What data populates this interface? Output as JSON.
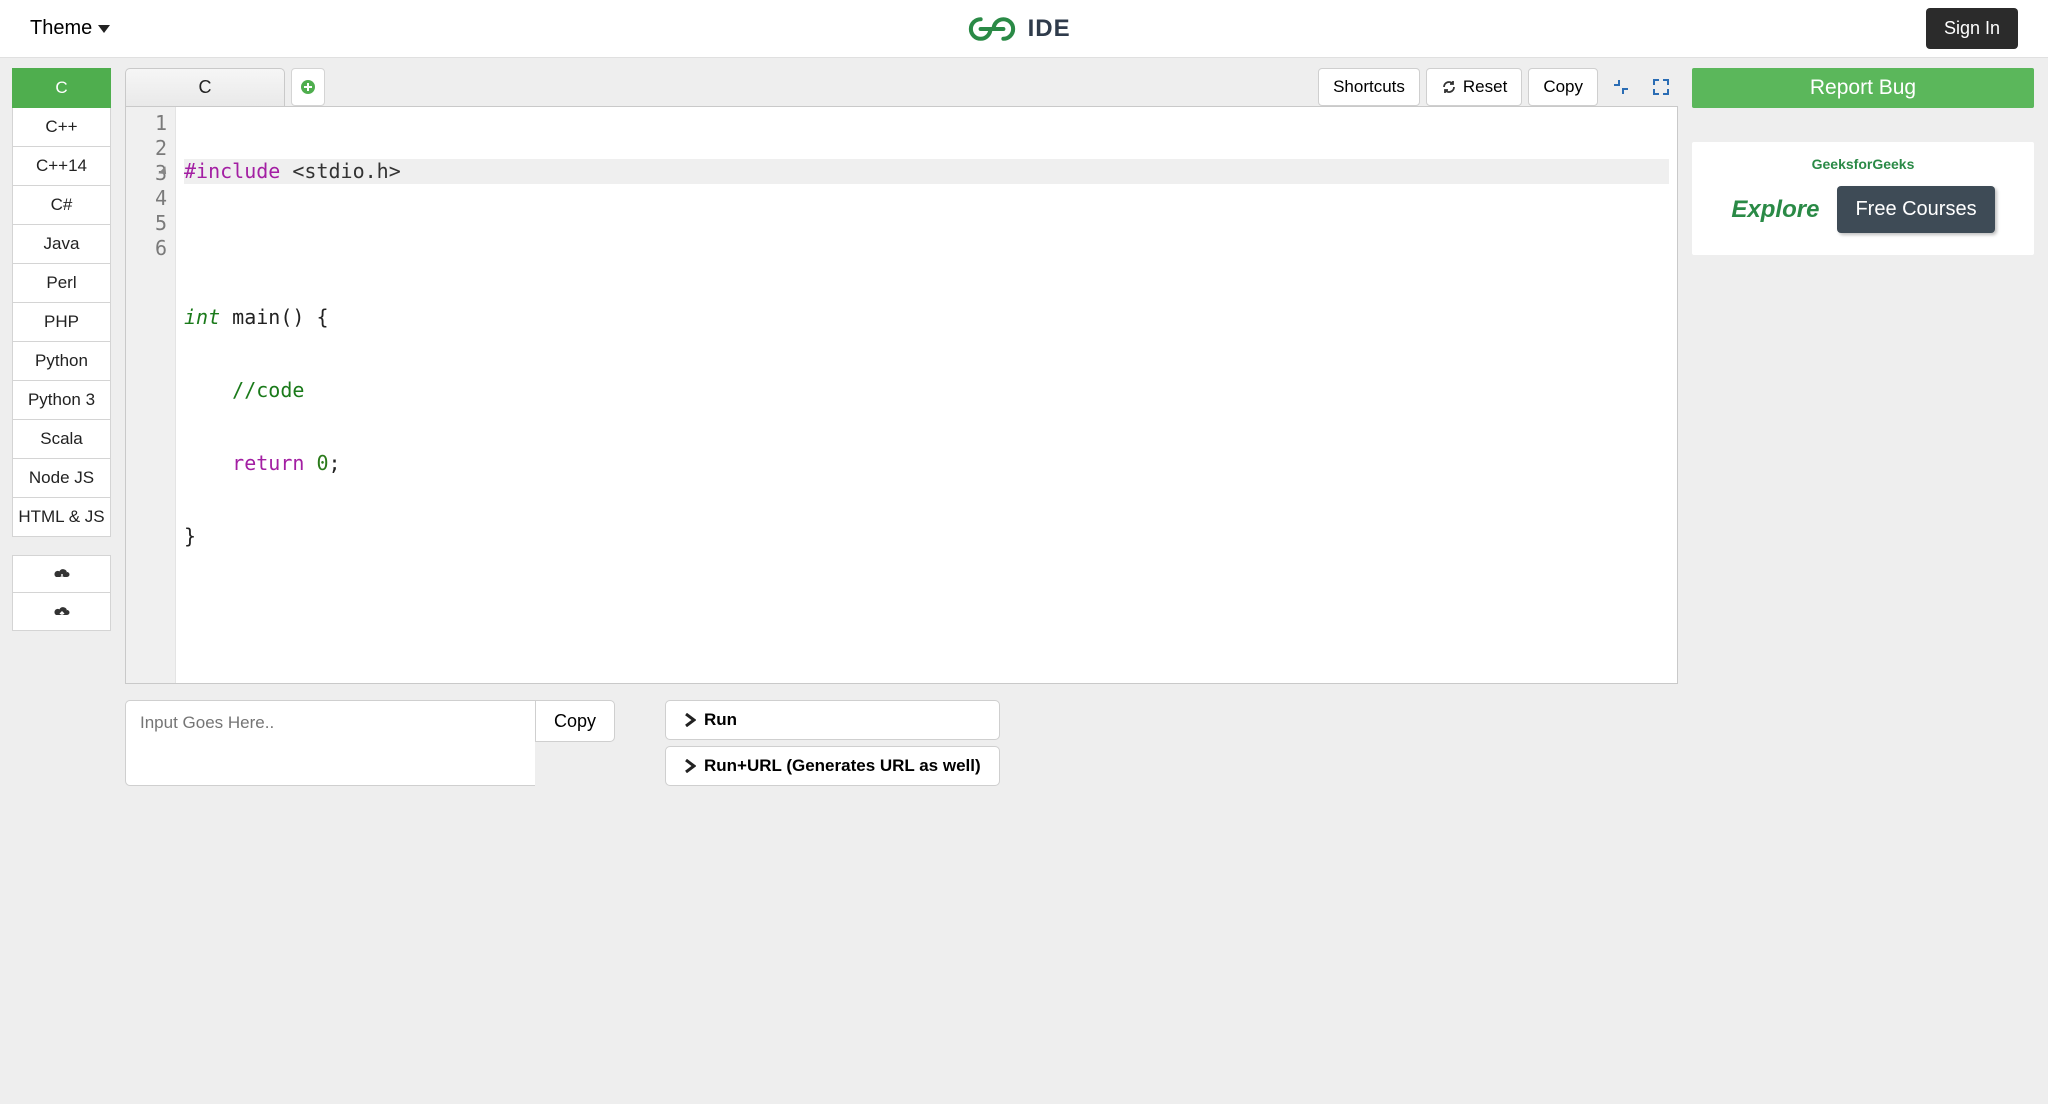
{
  "header": {
    "theme_label": "Theme",
    "ide_label": "IDE",
    "signin_label": "Sign In"
  },
  "sidebar": {
    "languages": [
      "C",
      "C++",
      "C++14",
      "C#",
      "Java",
      "Perl",
      "PHP",
      "Python",
      "Python 3",
      "Scala",
      "Node JS",
      "HTML & JS"
    ],
    "active_index": 0
  },
  "tabs": {
    "items": [
      "C"
    ]
  },
  "toolbar": {
    "shortcuts_label": "Shortcuts",
    "reset_label": "Reset",
    "copy_label": "Copy"
  },
  "editor": {
    "line_count": 6,
    "fold_line": 3,
    "highlight_line": 1,
    "tokens": {
      "l1_pre": "#include",
      "l1_ang": " <stdio.h>",
      "l3_type": "int",
      "l3_rest": " main() {",
      "l4_cmt": "    //code",
      "l5_kw": "    return",
      "l5_num": " 0",
      "l5_semi": ";",
      "l6": "}"
    }
  },
  "input": {
    "placeholder": "Input Goes Here..",
    "copy_label": "Copy"
  },
  "run": {
    "run_label": "Run",
    "run_url_label": "Run+URL (Generates URL as well)"
  },
  "right": {
    "report_bug_label": "Report Bug",
    "promo_brand": "GeeksforGeeks",
    "promo_explore": "Explore",
    "promo_button": "Free Courses"
  }
}
